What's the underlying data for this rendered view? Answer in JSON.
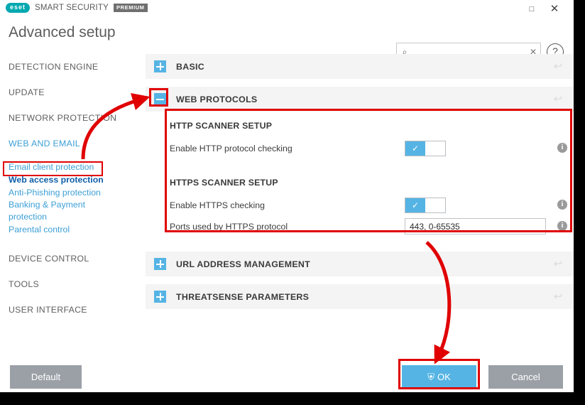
{
  "window": {
    "brand": "eset",
    "product": "SMART SECURITY",
    "edition": "PREMIUM",
    "maximize_label": "□",
    "close_label": "✕"
  },
  "header": {
    "title": "Advanced setup",
    "search_value": "",
    "search_placeholder": "",
    "search_icon": "⌕",
    "clear_label": "✕",
    "help_label": "?"
  },
  "sidebar": {
    "items": [
      {
        "label": "DETECTION ENGINE",
        "type": "group",
        "selected": false
      },
      {
        "label": "UPDATE",
        "type": "group",
        "selected": false
      },
      {
        "label": "NETWORK PROTECTION",
        "type": "group",
        "selected": false
      },
      {
        "label": "WEB AND EMAIL",
        "type": "group-active",
        "selected": false
      },
      {
        "label": "Email client protection",
        "type": "sub",
        "selected": false
      },
      {
        "label": "Web access protection",
        "type": "sub",
        "selected": true
      },
      {
        "label": "Anti-Phishing protection",
        "type": "sub",
        "selected": false
      },
      {
        "label": "Banking & Payment protection",
        "type": "sub",
        "selected": false
      },
      {
        "label": "Parental control",
        "type": "sub",
        "selected": false
      },
      {
        "label": "DEVICE CONTROL",
        "type": "group",
        "selected": false
      },
      {
        "label": "TOOLS",
        "type": "group",
        "selected": false
      },
      {
        "label": "USER INTERFACE",
        "type": "group",
        "selected": false
      }
    ]
  },
  "content": {
    "sections": [
      {
        "title": "BASIC",
        "expanded": false
      },
      {
        "title": "WEB PROTOCOLS",
        "expanded": true
      },
      {
        "title": "URL ADDRESS MANAGEMENT",
        "expanded": false
      },
      {
        "title": "THREATSENSE PARAMETERS",
        "expanded": false
      }
    ],
    "web_protocols": {
      "http_group_title": "HTTP SCANNER SETUP",
      "http_enable_label": "Enable HTTP protocol checking",
      "http_enable_value": "on",
      "https_group_title": "HTTPS SCANNER SETUP",
      "https_enable_label": "Enable HTTPS checking",
      "https_enable_value": "on",
      "https_ports_label": "Ports used by HTTPS protocol",
      "https_ports_value": "443, 0-65535"
    },
    "toggle_on_glyph": "✓",
    "revert_glyph": "↩",
    "info_glyph": "i"
  },
  "footer": {
    "default_label": "Default",
    "ok_label": "OK",
    "ok_icon": "⛨",
    "cancel_label": "Cancel"
  },
  "annotations": {
    "accent_red": "#e00000",
    "accent_blue": "#55b4e4",
    "brand_teal": "#00a8b0",
    "link_blue": "#3c9fd6",
    "selected_blue": "#0f5ea8"
  }
}
